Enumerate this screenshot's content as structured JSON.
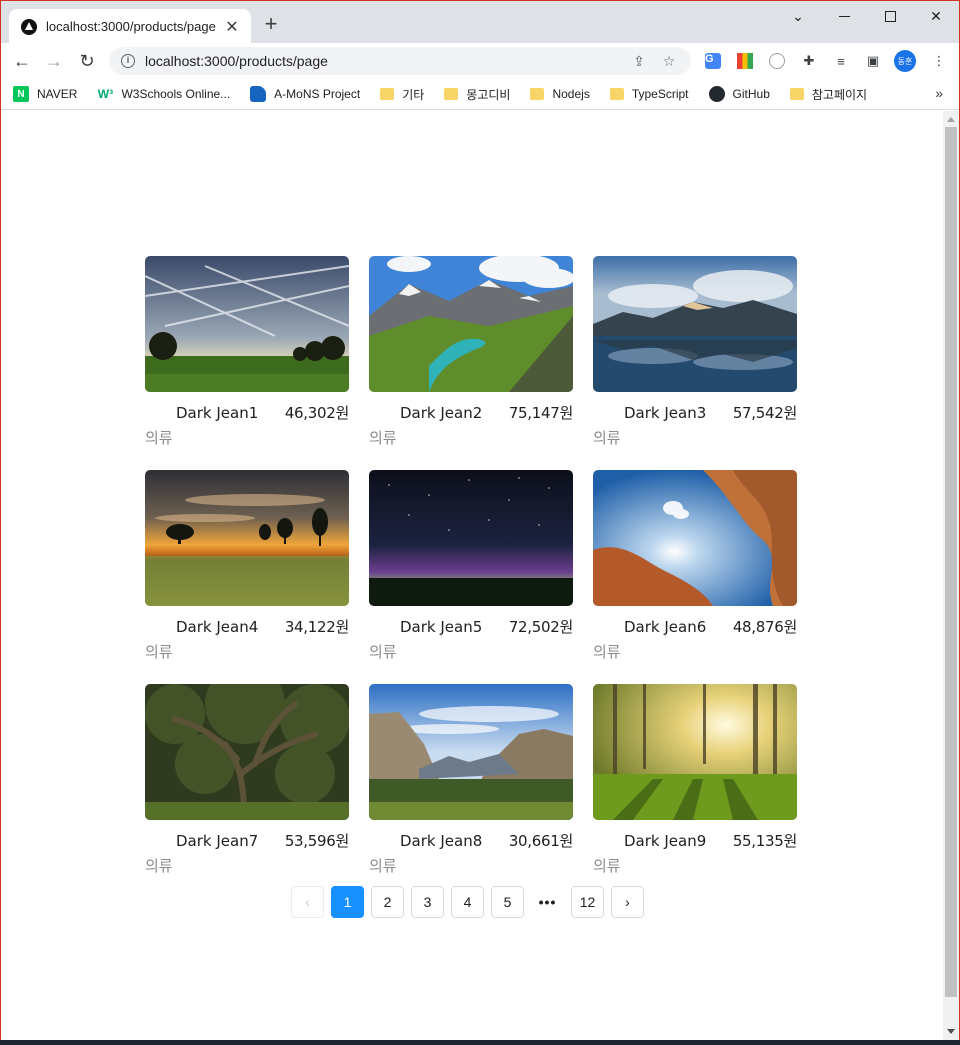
{
  "browser": {
    "tab_title": "localhost:3000/products/page",
    "tab_close": "✕",
    "new_tab": "+",
    "url": "localhost:3000/products/page",
    "profile_initials": "동훈",
    "bookmarks": [
      {
        "label": "NAVER",
        "icon": "naver-icon"
      },
      {
        "label": "W3Schools Online...",
        "icon": "w3schools-icon"
      },
      {
        "label": "A-MoNS Project",
        "icon": "amons-icon"
      },
      {
        "label": "기타",
        "icon": "folder-icon"
      },
      {
        "label": "몽고디비",
        "icon": "folder-icon"
      },
      {
        "label": "Nodejs",
        "icon": "folder-icon"
      },
      {
        "label": "TypeScript",
        "icon": "folder-icon"
      },
      {
        "label": "GitHub",
        "icon": "github-icon"
      },
      {
        "label": "참고페이지",
        "icon": "folder-icon"
      }
    ],
    "bookmarks_more": "»"
  },
  "products": [
    {
      "name": "Dark Jean1",
      "price": "46,302원",
      "category": "의류",
      "image": "sky-contrails-field"
    },
    {
      "name": "Dark Jean2",
      "price": "75,147원",
      "category": "의류",
      "image": "mountain-lake-valley"
    },
    {
      "name": "Dark Jean3",
      "price": "57,542원",
      "category": "의류",
      "image": "mountain-lake-reflection"
    },
    {
      "name": "Dark Jean4",
      "price": "34,122원",
      "category": "의류",
      "image": "sunset-meadow-trees"
    },
    {
      "name": "Dark Jean5",
      "price": "72,502원",
      "category": "의류",
      "image": "starry-night-aurora"
    },
    {
      "name": "Dark Jean6",
      "price": "48,876원",
      "category": "의류",
      "image": "red-canyon-sky"
    },
    {
      "name": "Dark Jean7",
      "price": "53,596원",
      "category": "의류",
      "image": "ancient-tree-forest"
    },
    {
      "name": "Dark Jean8",
      "price": "30,661원",
      "category": "의류",
      "image": "yosemite-valley"
    },
    {
      "name": "Dark Jean9",
      "price": "55,135원",
      "category": "의류",
      "image": "sunlit-forest"
    }
  ],
  "pagination": {
    "prev": "‹",
    "next": "›",
    "pages": [
      "1",
      "2",
      "3",
      "4",
      "5"
    ],
    "ellipsis": "•••",
    "last": "12",
    "current": "1"
  }
}
